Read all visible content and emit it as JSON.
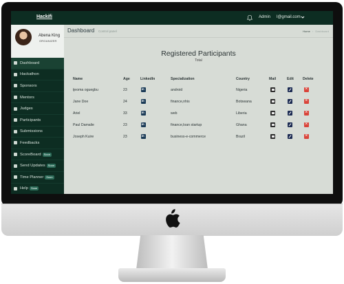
{
  "topbar": {
    "brand": "Hackifi",
    "admin": "Admin",
    "email": "l@gmail.com"
  },
  "profile": {
    "name": "Abena King",
    "role": "ORGANIZER"
  },
  "sidebar": {
    "items": [
      {
        "label": "Dashboard",
        "active": true,
        "soon": ""
      },
      {
        "label": "Hackathon",
        "soon": ""
      },
      {
        "label": "Sponsors",
        "soon": ""
      },
      {
        "label": "Mentors",
        "soon": ""
      },
      {
        "label": "Judges",
        "soon": ""
      },
      {
        "label": "Participants",
        "soon": ""
      },
      {
        "label": "Submissions",
        "soon": ""
      },
      {
        "label": "Feedbacks",
        "soon": ""
      },
      {
        "label": "ScoreBoard",
        "soon": "Soon"
      },
      {
        "label": "Send Updates",
        "soon": "Soon"
      },
      {
        "label": "Time Planner",
        "soon": "Soon"
      },
      {
        "label": "Help",
        "soon": "Soon"
      }
    ]
  },
  "page": {
    "title": "Dashboard",
    "subtitle": "Control panel",
    "breadcrumb": {
      "home": "Home",
      "current": "Dashboard"
    },
    "heading": "Registered Participants",
    "subheading": "Total"
  },
  "table": {
    "headers": [
      "Name",
      "Age",
      "LinkedIn",
      "Specialization",
      "Country",
      "Mail",
      "Edit",
      "Delete"
    ],
    "rows": [
      {
        "name": "ijeoma oguegbu",
        "age": "23",
        "spec": "android",
        "country": "Nigeria"
      },
      {
        "name": "Jane Doe",
        "age": "24",
        "spec": "finance,nhis",
        "country": "Botswana"
      },
      {
        "name": "Ariel",
        "age": "33",
        "spec": "web",
        "country": "Liberia"
      },
      {
        "name": "Paul Damalie",
        "age": "23",
        "spec": "finance,loan startup",
        "country": "Ghana"
      },
      {
        "name": "Joseph Kuire",
        "age": "23",
        "spec": "business-e-commerce",
        "country": "Brazil"
      }
    ]
  },
  "colors": {
    "sidebar": "#0d2d22",
    "content": "#d7dcd6",
    "delete": "#d9443a",
    "edit": "#1b2a52"
  }
}
